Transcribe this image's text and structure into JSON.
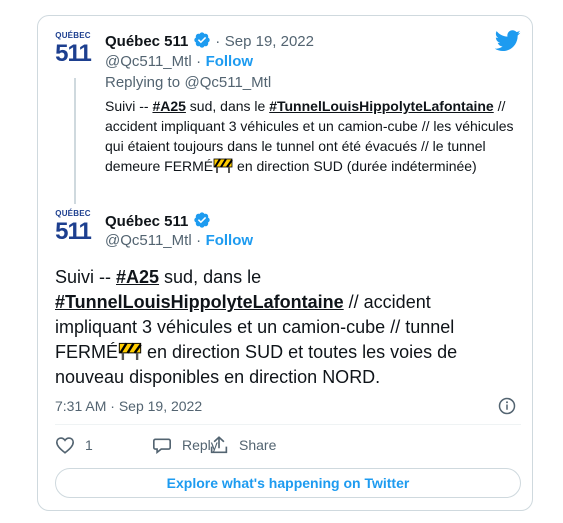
{
  "quoted_tweet": {
    "logo_top": "QUÉBEC",
    "logo_num": "511",
    "author_name": "Québec 511",
    "separator": "·",
    "date": "Sep 19, 2022",
    "handle": "@Qc511_Mtl",
    "follow_label": "Follow",
    "replying_label": "Replying to",
    "replying_handle": "@Qc511_Mtl",
    "text_prefix": "Suivi -- ",
    "hashtag1": "#A25",
    "text_mid": " sud, dans le ",
    "hashtag2": "#TunnelLouisHippolyteLafontaine",
    "text_body1": " // accident impliquant 3 véhicules et un camion-cube // les véhicules qui étaient toujours dans le tunnel ont été évacués // le tunnel demeure FERMÉ",
    "text_body2": " en direction SUD (durée indéterminée)"
  },
  "main_tweet": {
    "logo_top": "QUÉBEC",
    "logo_num": "511",
    "author_name": "Québec 511",
    "handle": "@Qc511_Mtl",
    "separator": "·",
    "follow_label": "Follow",
    "text_prefix": "Suivi -- ",
    "hashtag1": "#A25",
    "text_mid": " sud, dans le",
    "hashtag2": "#TunnelLouisHippolyteLafontaine",
    "text_body1": " // accident impliquant 3 véhicules et un camion-cube // tunnel FERMÉ",
    "text_body2": " en direction SUD et toutes les voies de nouveau disponibles en direction NORD.",
    "time": "7:31 AM",
    "date": "Sep 19, 2022"
  },
  "actions": {
    "like_count": "1",
    "reply_label": "Reply",
    "share_label": "Share"
  },
  "explore_label": "Explore what's happening on Twitter",
  "colors": {
    "accent": "#1d9bf0",
    "text": "#0f1419",
    "muted": "#536471",
    "border": "#cfd9de",
    "logo_blue": "#1d3f8f"
  },
  "icons": {
    "verified": "verified-badge-icon",
    "twitter": "twitter-bird-icon",
    "info": "info-icon",
    "like": "heart-icon",
    "reply": "speech-bubble-icon",
    "share": "share-upload-icon",
    "barrier": "construction-barrier-emoji"
  }
}
